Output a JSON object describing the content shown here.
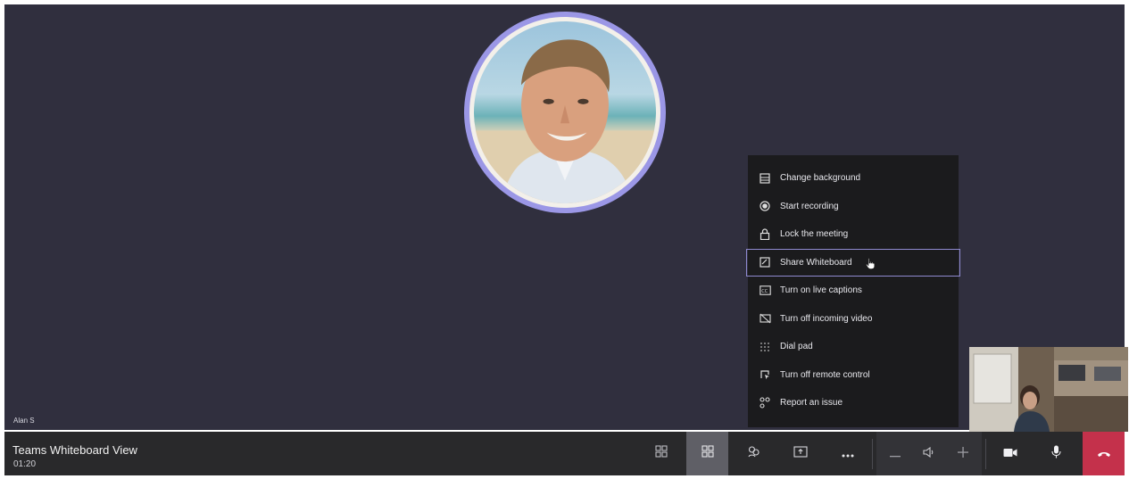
{
  "participant": {
    "name_label": "Alan S"
  },
  "meeting": {
    "title": "Teams Whiteboard View",
    "time": "01:20"
  },
  "more_menu": {
    "items": [
      {
        "label": "Change background",
        "icon": "background-icon"
      },
      {
        "label": "Start recording",
        "icon": "record-icon"
      },
      {
        "label": "Lock the meeting",
        "icon": "lock-icon"
      },
      {
        "label": "Share Whiteboard",
        "icon": "whiteboard-icon",
        "hovered": true
      },
      {
        "label": "Turn on live captions",
        "icon": "captions-icon"
      },
      {
        "label": "Turn off incoming video",
        "icon": "video-off-icon"
      },
      {
        "label": "Dial pad",
        "icon": "dialpad-icon"
      },
      {
        "label": "Turn off remote control",
        "icon": "remote-control-icon"
      },
      {
        "label": "Report an issue",
        "icon": "report-issue-icon"
      }
    ]
  },
  "colors": {
    "stage": "#302f3e",
    "avatar_ring": "#9b97e6",
    "menu_bg": "#1b1b1d",
    "hangup": "#c4314b",
    "bar": "#29292b"
  }
}
